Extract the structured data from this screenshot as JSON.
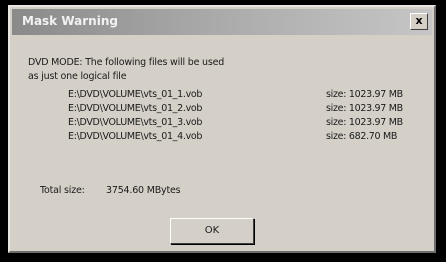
{
  "dialog": {
    "title": "Mask Warning",
    "close_glyph": "x",
    "message_line1": "DVD MODE: The following files will be used",
    "message_line2": "as just one logical file",
    "files": [
      {
        "path": "E:\\DVD\\VOLUME\\vts_01_1.vob",
        "size": "size: 1023.97 MB"
      },
      {
        "path": "E:\\DVD\\VOLUME\\vts_01_2.vob",
        "size": "size: 1023.97 MB"
      },
      {
        "path": "E:\\DVD\\VOLUME\\vts_01_3.vob",
        "size": "size: 1023.97 MB"
      },
      {
        "path": "E:\\DVD\\VOLUME\\vts_01_4.vob",
        "size": "size: 682.70 MB"
      }
    ],
    "total_label": "Total size:",
    "total_value": "3754.60 MBytes",
    "ok_label": "OK"
  },
  "colors": {
    "background": "#000000",
    "dialog_face": "#d4d0c8",
    "titlebar_start": "#8a8a8a",
    "titlebar_end": "#c6c6c6",
    "text": "#1a1a1a"
  }
}
